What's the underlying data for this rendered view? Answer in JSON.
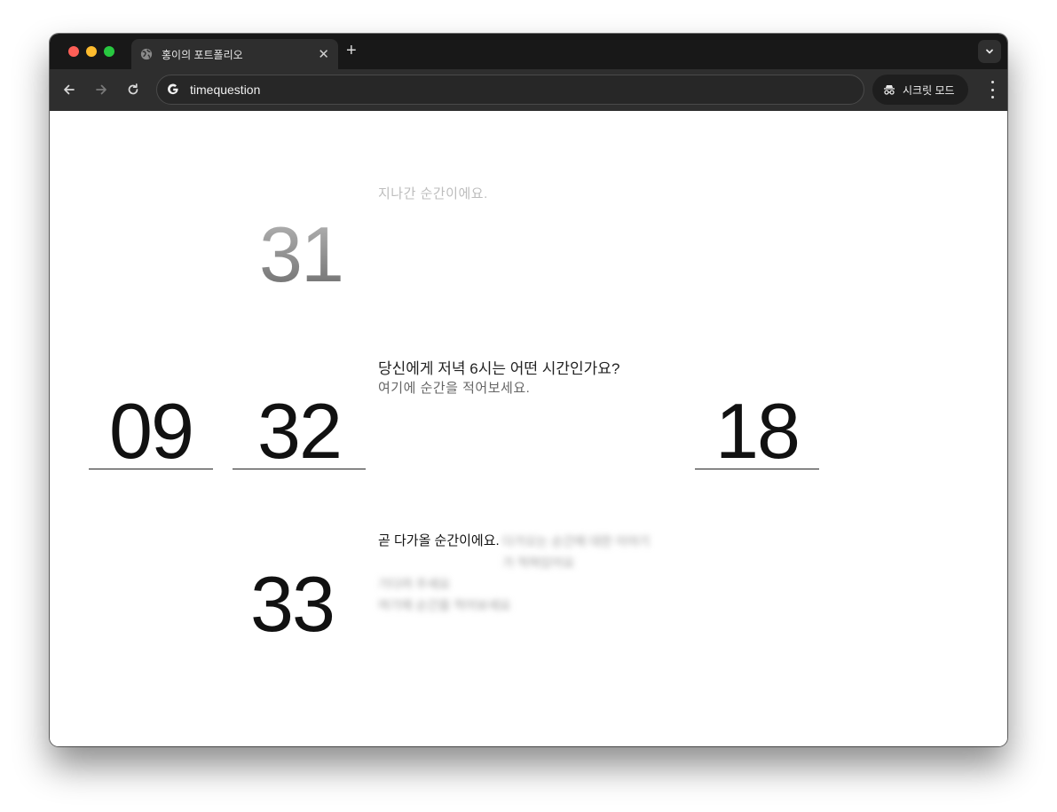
{
  "browser": {
    "tab_title": "홍이의 포트폴리오",
    "tab_close": "✕",
    "new_tab": "+",
    "url": "timequestion",
    "incognito_label": "시크릿 모드"
  },
  "page": {
    "prev_minute": "31",
    "prev_caption": "지나간 순간이에요.",
    "current_hour": "09",
    "current_minute": "32",
    "next_minute": "33",
    "question": "당신에게 저녁 6시는 어떤 시간인가요?",
    "answer_placeholder": "여기에 순간을 적어보세요.",
    "target_hour": "18",
    "next_caption": "곧 다가올 순간이에요.",
    "blurred_lines": [
      "다가오는 순간에 대한 이야기가 적혀있어요",
      "기다려 주세요",
      "여기에 순간을 적어보세요"
    ]
  },
  "colors": {
    "titlebar": "#181818",
    "toolbar": "#2e2e2e",
    "tab_active": "#2e2e2e",
    "close_red": "#fe5f57",
    "minimize_yellow": "#febc2e",
    "zoom_green": "#28c840"
  }
}
